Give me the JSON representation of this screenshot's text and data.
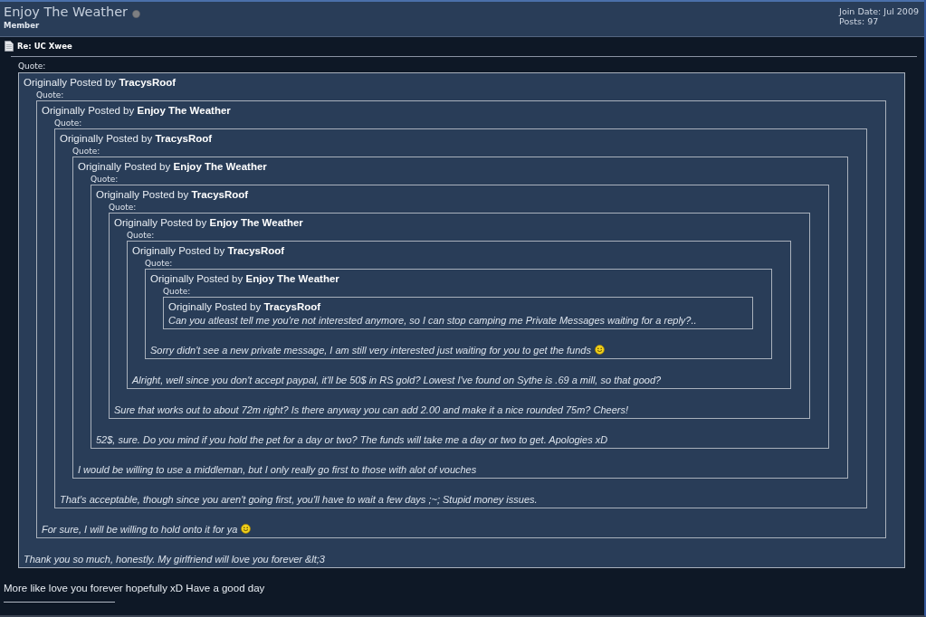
{
  "profile": {
    "username": "Enjoy The Weather",
    "online": false,
    "user_title": "Member",
    "join_date": "Join Date: Jul 2009",
    "posts": "Posts: 97"
  },
  "post": {
    "title": "Re: UC Xwee",
    "quote": {
      "label": "Quote:",
      "posted_by": "Originally Posted by **TracysRoof**",
      "quote": {
        "label": "Quote:",
        "posted_by": "Originally Posted by **Enjoy The Weather**",
        "quote": {
          "label": "Quote:",
          "posted_by": "Originally Posted by **TracysRoof**",
          "quote": {
            "label": "Quote:",
            "posted_by": "Originally Posted by **Enjoy The Weather**",
            "quote": {
              "label": "Quote:",
              "posted_by": "Originally Posted by **TracysRoof**",
              "quote": {
                "label": "Quote:",
                "posted_by": "Originally Posted by **Enjoy The Weather**",
                "quote": {
                  "label": "Quote:",
                  "posted_by": "Originally Posted by **TracysRoof**",
                  "quote": {
                    "label": "Quote:",
                    "posted_by": "Originally Posted by **Enjoy The Weather**",
                    "quote": {
                      "label": "Quote:",
                      "posted_by": "Originally Posted by **TracysRoof**",
                      "message": "Can you atleast tell me you're not interested anymore, so I can stop camping me Private Messages waiting for a reply?.."
                    },
                    "message": "Sorry didn't see a new private message, I am still very interested just waiting for you to get the funds",
                    "smiley": true
                  },
                  "message": "Alright, well since you don't accept paypal, it'll be 50$ in RS gold? Lowest I've found on Sythe is .69 a mill, so that good?"
                },
                "message": "Sure that works out to about 72m right? Is there anyway you can add 2.00 and make it a nice rounded 75m? Cheers!"
              },
              "message": "52$, sure. Do you mind if you hold the pet for a day or two? The funds will take me a day or two to get. Apologies xD"
            },
            "message": "I would be willing to use a middleman, but I only really go first to those with alot of vouches"
          },
          "message": "That's acceptable, though since you aren't going first, you'll have to wait a few days ;~; Stupid money issues."
        },
        "message": "For sure, I will be willing to hold onto it for ya",
        "smiley": true
      },
      "message": "Thank you so much, honestly. My girlfriend will love you forever &lt;3"
    },
    "message": "More like love you forever hopefully xD Have a good day"
  }
}
